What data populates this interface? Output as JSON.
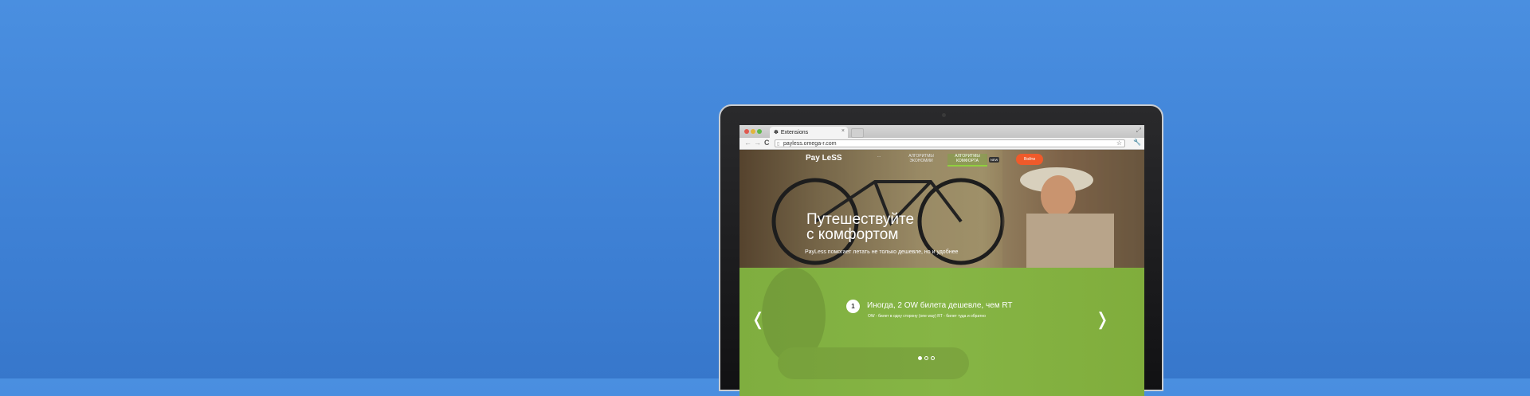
{
  "browser": {
    "tab_title": "Extensions",
    "tab_close": "×",
    "address": "payless.omega-r.com",
    "back": "←",
    "forward": "→",
    "reload": "C"
  },
  "site": {
    "logo": "Pay LeSS",
    "nav": [
      {
        "label": "…"
      },
      {
        "label": "АЛГОРИТМЫ ЭКОНОМИИ"
      },
      {
        "label": "АЛГОРИТМЫ КОМФОРТА"
      }
    ],
    "nav_badge": "NEW",
    "cta": "Войти",
    "hero_title_line1": "Путешествуйте",
    "hero_title_line2": "с комфортом",
    "hero_subtitle": "PayLess помогает летать не только дешевле, но и удобнее",
    "slide_number": "1",
    "slide_title": "Иногда, 2 OW билета дешевле, чем RT",
    "slide_text": "OW - билет в одну сторону (one way) RT - билет туда и обратно",
    "prev": "❬",
    "next": "❭"
  },
  "colors": {
    "background": "#4a8fe0",
    "accent_green": "#86b545",
    "cta_orange": "#ef5a2a"
  }
}
